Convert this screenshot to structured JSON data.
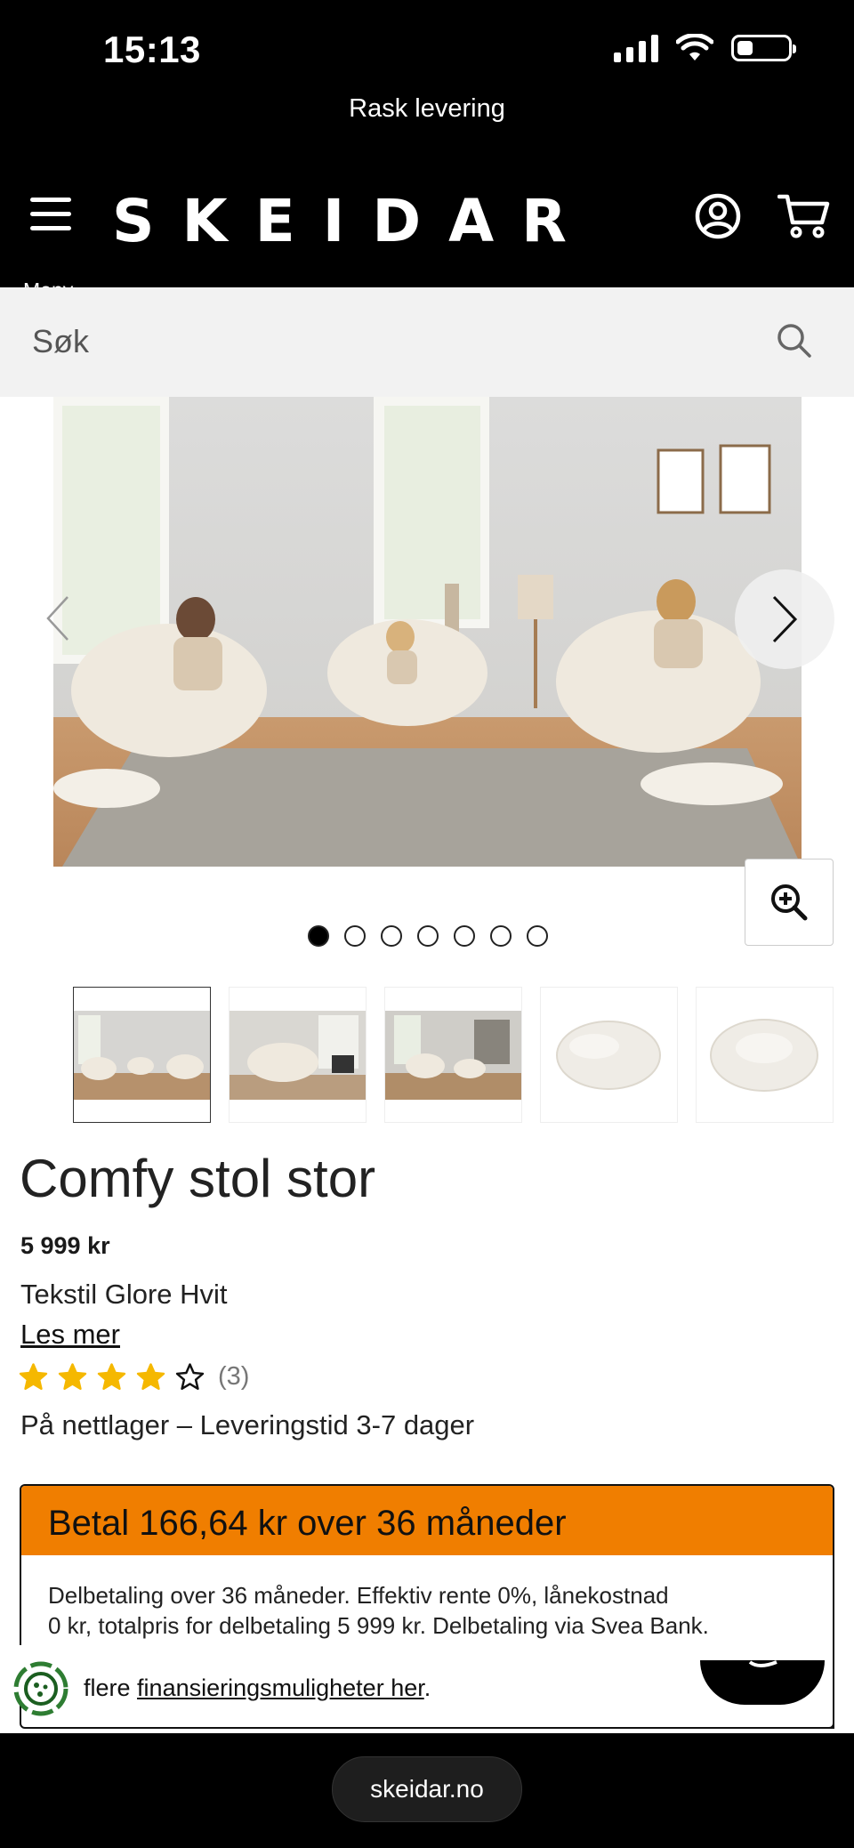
{
  "status_bar": {
    "time": "15:13",
    "battery_level": 0.3
  },
  "promo": {
    "text": "Rask levering"
  },
  "header": {
    "menu_label": "Meny",
    "logo": "SKEIDAR"
  },
  "search": {
    "placeholder": "Søk"
  },
  "gallery": {
    "image_count": 7,
    "active_index": 0,
    "thumbnails": [
      {
        "subject": "living room with three bouclé chairs"
      },
      {
        "subject": "single bouclé chair in room"
      },
      {
        "subject": "bouclé chairs in room"
      },
      {
        "subject": "bouclé chair product shot"
      },
      {
        "subject": "bouclé chair front view"
      }
    ]
  },
  "product": {
    "title": "Comfy stol stor",
    "price": "5 999 kr",
    "variant": "Tekstil Glore Hvit",
    "read_more": "Les mer",
    "rating": {
      "stars": 4,
      "max": 5,
      "count": "(3)"
    },
    "stock": "På nettlager – Leveringstid 3-7 dager"
  },
  "financing": {
    "header": "Betal 166,64 kr over 36 måneder",
    "body_line1": "Delbetaling over 36 måneder. Effektiv rente 0%, lånekostnad",
    "body_line2": "0 kr, totalpris for delbetaling 5 999 kr. Delbetaling via Svea Bank.",
    "more_prefix": "flere",
    "more_link": "finansieringsmuligheter her",
    "more_suffix": "."
  },
  "browser": {
    "url": "skeidar.no"
  },
  "colors": {
    "accent": "#f07e00",
    "header_bg": "#000000",
    "star": "#f5b800"
  }
}
